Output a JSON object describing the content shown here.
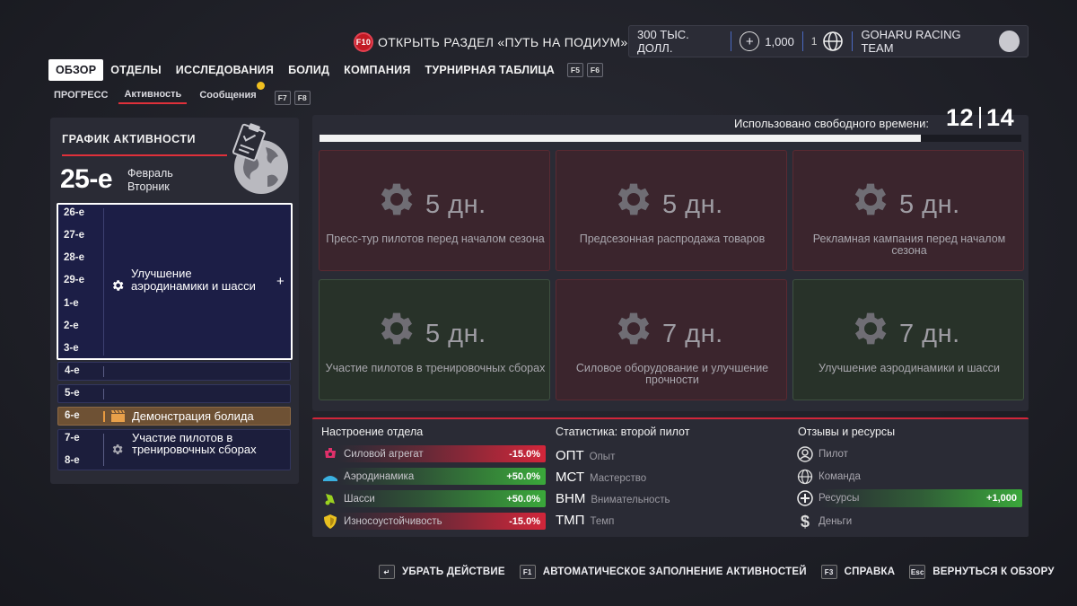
{
  "header": {
    "podium_key": "F10",
    "podium_label": "ОТКРЫТЬ РАЗДЕЛ «ПУТЬ НА ПОДИУМ»",
    "money": "300 ТЫС. ДОЛЛ.",
    "resources": "1,000",
    "rank_prefix": "1",
    "team_name": "GOHARU RACING TEAM"
  },
  "tabs": [
    {
      "label": "ОБЗОР",
      "active": true
    },
    {
      "label": "ОТДЕЛЫ"
    },
    {
      "label": "ИССЛЕДОВАНИЯ"
    },
    {
      "label": "БОЛИД"
    },
    {
      "label": "КОМПАНИЯ"
    },
    {
      "label": "ТУРНИРНАЯ ТАБЛИЦА"
    }
  ],
  "tab_keys": [
    "F5",
    "F6"
  ],
  "subtabs": [
    {
      "label": "ПРОГРЕСС"
    },
    {
      "label": "Активность",
      "active": true
    },
    {
      "label": "Сообщения",
      "notification": true
    }
  ],
  "subtab_keys": [
    "F7",
    "F8"
  ],
  "schedule": {
    "title": "ГРАФИК АКТИВНОСТИ",
    "current_day": "25-е",
    "month": "Февраль",
    "weekday": "Вторник",
    "selected_days": [
      "26-е",
      "27-е",
      "28-е",
      "29-е",
      "1-е",
      "2-е",
      "3-е"
    ],
    "selected_activity": "Улучшение аэродинамики и шасси",
    "selected_action": "+",
    "rows": [
      {
        "day": "4-е",
        "activity": ""
      },
      {
        "day": "5-е",
        "activity": ""
      },
      {
        "day": "6-е",
        "activity": "Демонстрация болида"
      },
      {
        "day": "7-е",
        "activity": "Участие пилотов в тренировочных сборах"
      },
      {
        "day": "8-е",
        "activity": ""
      }
    ]
  },
  "free_time": {
    "label": "Использовано свободного времени:",
    "used": "12",
    "total": "14",
    "fraction": 0.857
  },
  "activities": [
    {
      "days": "5 дн.",
      "label": "Пресс-тур пилотов перед началом сезона",
      "category": "red"
    },
    {
      "days": "5 дн.",
      "label": "Предсезонная распродажа товаров",
      "category": "red"
    },
    {
      "days": "5 дн.",
      "label": "Рекламная кампания перед началом сезона",
      "category": "red"
    },
    {
      "days": "5 дн.",
      "label": "Участие пилотов в тренировочных сборах",
      "category": "green"
    },
    {
      "days": "7 дн.",
      "label": "Силовое оборудование и улучшение прочности",
      "category": "red"
    },
    {
      "days": "7 дн.",
      "label": "Улучшение аэродинамики и шасси",
      "category": "green"
    }
  ],
  "department_mood": {
    "title": "Настроение отдела",
    "items": [
      {
        "name": "Силовой агрегат",
        "value": "-15.0%",
        "color": "#d2263a"
      },
      {
        "name": "Аэродинамика",
        "value": "+50.0%",
        "color": "#3aa83a"
      },
      {
        "name": "Шасси",
        "value": "+50.0%",
        "color": "#3aa83a"
      },
      {
        "name": "Износоустойчивость",
        "value": "-15.0%",
        "color": "#d2263a"
      }
    ]
  },
  "driver_stats": {
    "title": "Статистика: второй пилот",
    "items": [
      {
        "abbr": "ОПТ",
        "name": "Опыт"
      },
      {
        "abbr": "МСТ",
        "name": "Мастерство"
      },
      {
        "abbr": "ВНМ",
        "name": "Внимательность"
      },
      {
        "abbr": "ТМП",
        "name": "Темп"
      }
    ]
  },
  "feedback": {
    "title": "Отзывы и ресурсы",
    "items": [
      {
        "name": "Пилот",
        "icon": "driver-icon",
        "value": ""
      },
      {
        "name": "Команда",
        "icon": "team-globe-icon",
        "value": ""
      },
      {
        "name": "Ресурсы",
        "icon": "resources-icon",
        "value": "+1,000"
      },
      {
        "name": "Деньги",
        "icon": "money-icon",
        "value": ""
      }
    ]
  },
  "footer": [
    {
      "key": "↵",
      "label": "УБРАТЬ ДЕЙСТВИЕ"
    },
    {
      "key": "F1",
      "label": "АВТОМАТИЧЕСКОЕ ЗАПОЛНЕНИЕ АКТИВНОСТЕЙ"
    },
    {
      "key": "F3",
      "label": "СПРАВКА"
    },
    {
      "key": "Esc",
      "label": "ВЕРНУТЬСЯ К ОБЗОРУ"
    }
  ],
  "colors": {
    "accent": "#e0303a",
    "positive": "#3aa83a",
    "negative": "#d2263a",
    "selection": "#1c1e46",
    "highlight": "#6e5134"
  }
}
